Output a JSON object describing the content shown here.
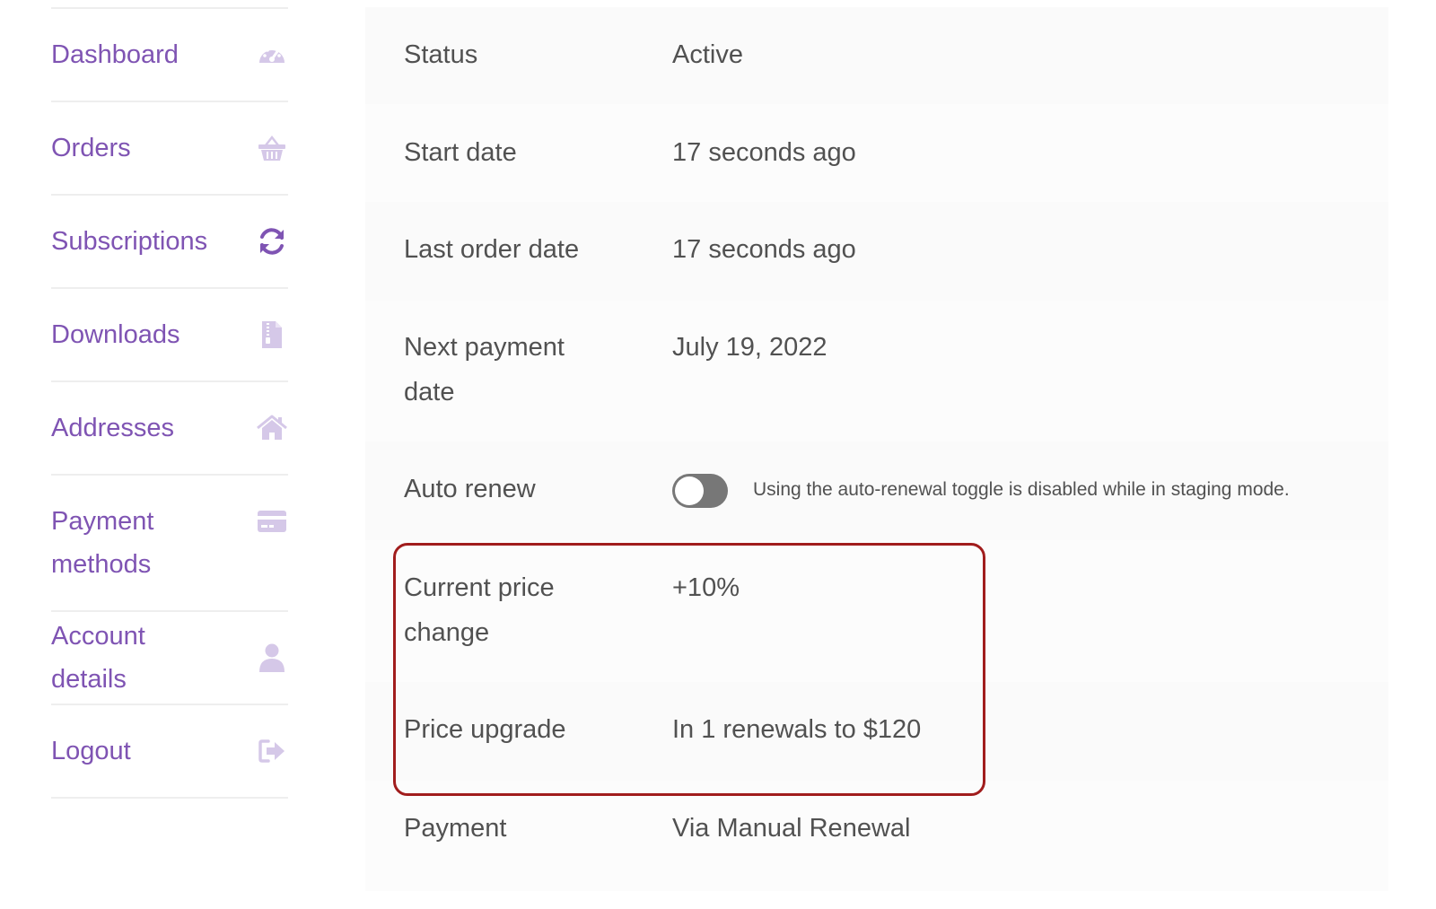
{
  "sidebar": {
    "items": [
      {
        "label": "Dashboard",
        "icon": "dashboard-gauge-icon"
      },
      {
        "label": "Orders",
        "icon": "basket-icon"
      },
      {
        "label": "Subscriptions",
        "icon": "refresh-icon"
      },
      {
        "label": "Downloads",
        "icon": "zip-file-icon"
      },
      {
        "label": "Addresses",
        "icon": "home-icon"
      },
      {
        "label": "Payment methods",
        "icon": "credit-card-icon"
      },
      {
        "label": "Account details",
        "icon": "user-icon"
      },
      {
        "label": "Logout",
        "icon": "logout-icon"
      }
    ]
  },
  "details": {
    "status": {
      "label": "Status",
      "value": "Active"
    },
    "start_date": {
      "label": "Start date",
      "value": "17 seconds ago"
    },
    "last_order_date": {
      "label": "Last order date",
      "value": "17 seconds ago"
    },
    "next_payment_date": {
      "label": "Next payment date",
      "value": "July 19, 2022"
    },
    "auto_renew": {
      "label": "Auto renew",
      "enabled": false,
      "note": "Using the auto-renewal toggle is disabled while in staging mode."
    },
    "current_price_change": {
      "label": "Current price change",
      "value": "+10%"
    },
    "price_upgrade": {
      "label": "Price upgrade",
      "value": "In 1 renewals to $120"
    },
    "payment": {
      "label": "Payment",
      "value": "Via Manual Renewal"
    }
  },
  "colors": {
    "accent": "#7f54b3",
    "icon_muted": "#d5c8e8",
    "icon_active": "#7f54b3",
    "highlight_border": "#a11d1d",
    "text": "#515151"
  }
}
